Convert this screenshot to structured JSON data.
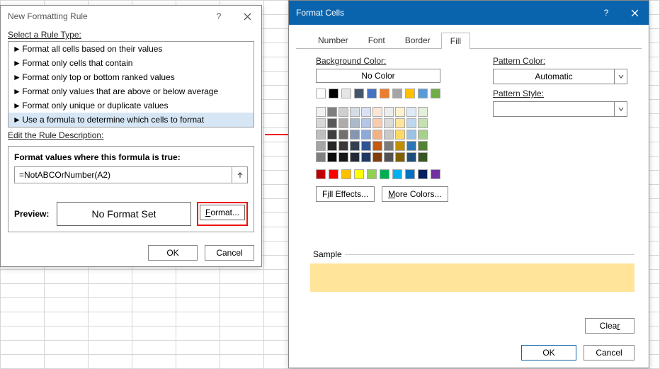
{
  "dlg1": {
    "title": "New Formatting Rule",
    "select_label": "Select a Rule Type:",
    "rules": [
      "Format all cells based on their values",
      "Format only cells that contain",
      "Format only top or bottom ranked values",
      "Format only values that are above or below average",
      "Format only unique or duplicate values",
      "Use a formula to determine which cells to format"
    ],
    "edit_label": "Edit the Rule Description:",
    "formula_label": "Format values where this formula is true:",
    "formula_value": "=NotABCOrNumber(A2)",
    "preview_label": "Preview:",
    "preview_text": "No Format Set",
    "format_btn": "Format...",
    "ok": "OK",
    "cancel": "Cancel"
  },
  "dlg2": {
    "title": "Format Cells",
    "help": "?",
    "tabs": {
      "number": "Number",
      "font": "Font",
      "border": "Border",
      "fill": "Fill"
    },
    "bg_label": "Background Color:",
    "no_color": "No Color",
    "fill_effects": "Fill Effects...",
    "more_colors": "More Colors...",
    "pattern_color_label": "Pattern Color:",
    "pattern_color_value": "Automatic",
    "pattern_style_label": "Pattern Style:",
    "sample_label": "Sample",
    "clear": "Clear",
    "ok": "OK",
    "cancel": "Cancel"
  },
  "colors": {
    "row_basic": [
      "#ffffff",
      "#000000",
      "#e7e6e6",
      "#44546a",
      "#4472c4",
      "#ed7d31",
      "#a5a5a5",
      "#ffc000",
      "#5b9bd5",
      "#70ad47"
    ],
    "theme_grid": [
      [
        "#f2f2f2",
        "#7f7f7f",
        "#d0cece",
        "#d6dce4",
        "#d9e2f3",
        "#fbe5d5",
        "#ededed",
        "#fff2cc",
        "#deebf6",
        "#e2efd9"
      ],
      [
        "#d8d8d8",
        "#595959",
        "#aeabab",
        "#adb9ca",
        "#b4c6e7",
        "#f7cbac",
        "#dbdbdb",
        "#fee599",
        "#bdd7ee",
        "#c5e0b3"
      ],
      [
        "#bfbfbf",
        "#3f3f3f",
        "#757070",
        "#8496b0",
        "#8eaadb",
        "#f4b183",
        "#c9c9c9",
        "#ffd965",
        "#9cc3e5",
        "#a8d08d"
      ],
      [
        "#a5a5a5",
        "#262626",
        "#3a3838",
        "#323f4f",
        "#2f5496",
        "#c55a11",
        "#7b7b7b",
        "#bf9000",
        "#2e75b5",
        "#538135"
      ],
      [
        "#7f7f7f",
        "#0c0c0c",
        "#171616",
        "#222a35",
        "#1f3864",
        "#833c0b",
        "#525252",
        "#7f6000",
        "#1e4e79",
        "#375623"
      ]
    ],
    "standard": [
      "#c00000",
      "#ff0000",
      "#ffc000",
      "#ffff00",
      "#92d050",
      "#00b050",
      "#00b0f0",
      "#0070c0",
      "#002060",
      "#7030a0"
    ]
  }
}
